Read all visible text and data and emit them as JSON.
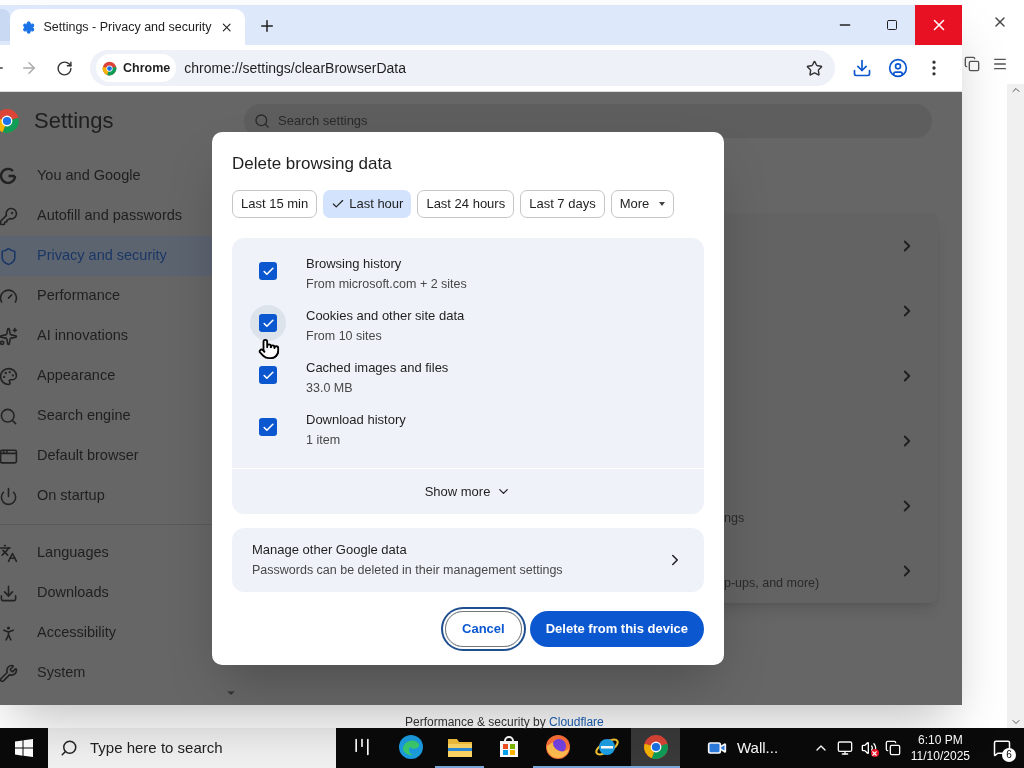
{
  "background_window": {
    "footer_text": "Performance & security by",
    "footer_link": "Cloudflare"
  },
  "browser": {
    "tab": {
      "title": "Settings - Privacy and security"
    },
    "address": {
      "chip": "Chrome",
      "url": "chrome://settings/clearBrowserData"
    }
  },
  "settings": {
    "title": "Settings",
    "search": {
      "placeholder": "Search settings"
    },
    "nav_groups": [
      {
        "items": [
          {
            "label": "You and Google",
            "selected": false
          },
          {
            "label": "Autofill and passwords",
            "selected": false
          },
          {
            "label": "Privacy and security",
            "selected": true
          },
          {
            "label": "Performance",
            "selected": false
          },
          {
            "label": "AI innovations",
            "selected": false
          },
          {
            "label": "Appearance",
            "selected": false
          },
          {
            "label": "Search engine",
            "selected": false
          },
          {
            "label": "Default browser",
            "selected": false
          },
          {
            "label": "On startup",
            "selected": false
          }
        ]
      },
      {
        "items": [
          {
            "label": "Languages",
            "selected": false
          },
          {
            "label": "Downloads",
            "selected": false
          },
          {
            "label": "Accessibility",
            "selected": false
          },
          {
            "label": "System",
            "selected": false
          }
        ]
      }
    ],
    "card_rows": [
      {
        "kind": "link"
      },
      {
        "kind": "link"
      },
      {
        "kind": "link"
      },
      {
        "kind": "link"
      },
      {
        "kind": "link",
        "description": "ngs"
      },
      {
        "kind": "link",
        "description": "p-ups, and more)"
      }
    ]
  },
  "dialog": {
    "title": "Delete browsing data",
    "ranges": [
      {
        "label": "Last 15 min",
        "selected": false,
        "kind": "chip"
      },
      {
        "label": "Last hour",
        "selected": true,
        "kind": "chip"
      },
      {
        "label": "Last 24 hours",
        "selected": false,
        "kind": "chip"
      },
      {
        "label": "Last 7 days",
        "selected": false,
        "kind": "chip"
      },
      {
        "label": "More",
        "selected": false,
        "kind": "menu"
      }
    ],
    "items": [
      {
        "title": "Browsing history",
        "subtitle": "From microsoft.com + 2 sites",
        "checked": true,
        "hovered": false
      },
      {
        "title": "Cookies and other site data",
        "subtitle": "From 10 sites",
        "checked": true,
        "hovered": true
      },
      {
        "title": "Cached images and files",
        "subtitle": "33.0 MB",
        "checked": true,
        "hovered": false
      },
      {
        "title": "Download history",
        "subtitle": "1 item",
        "checked": true,
        "hovered": false
      }
    ],
    "show_more": "Show more",
    "manage": {
      "title": "Manage other Google data",
      "subtitle": "Passwords can be deleted in their management settings"
    },
    "buttons": [
      {
        "label": "Cancel",
        "kind": "secondary"
      },
      {
        "label": "Delete from this device",
        "kind": "primary"
      }
    ]
  },
  "taskbar": {
    "search": {
      "placeholder": "Type here to search"
    },
    "apps": [
      {
        "running": false,
        "active": false
      },
      {
        "running": false,
        "active": false
      },
      {
        "running": true,
        "active": false
      },
      {
        "running": false,
        "active": false
      },
      {
        "running": true,
        "active": false
      },
      {
        "running": true,
        "active": false
      },
      {
        "running": true,
        "active": true
      }
    ],
    "window_button": {
      "label": "Wall..."
    },
    "volume": {
      "muted": true
    },
    "time": "6:10 PM",
    "date": "11/10/2025",
    "notifications": "6"
  }
}
